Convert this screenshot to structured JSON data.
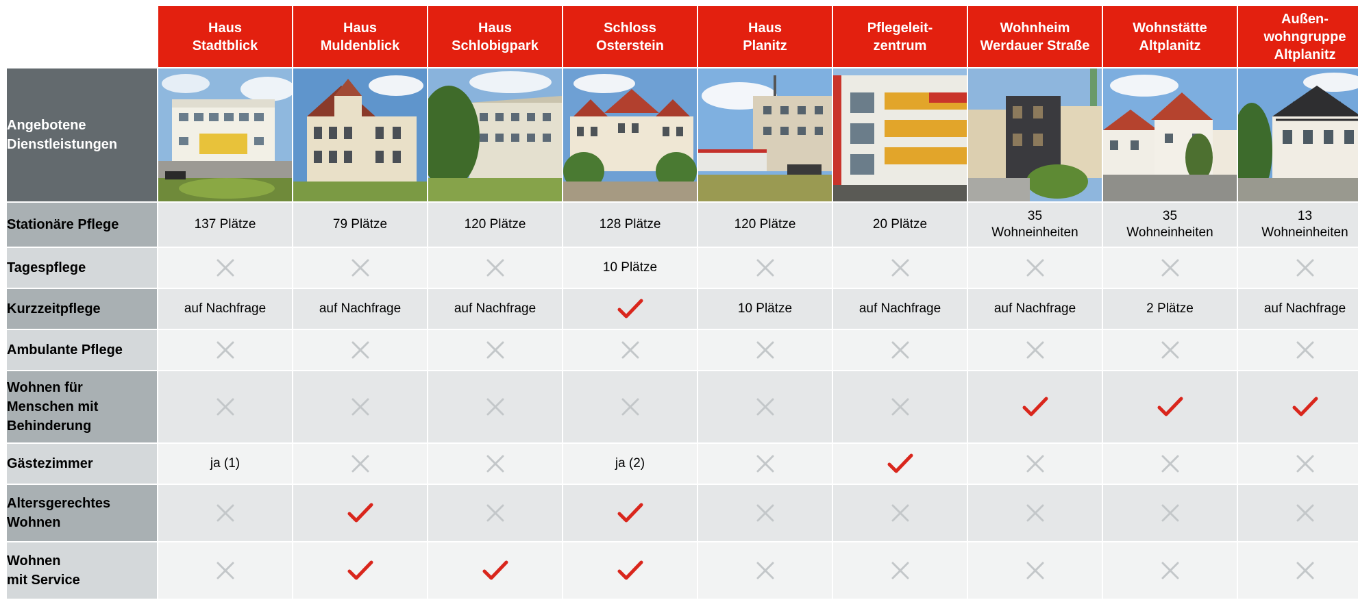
{
  "colors": {
    "brand_red": "#e3200f",
    "label_dark_gray": "#636a6e",
    "check_red": "#d9261c",
    "cross_gray": "#c3c7c9"
  },
  "intro_label": "Angebotene\nDienstleistungen",
  "houses": [
    {
      "name": "Haus\nStadtblick",
      "photo": "photo-haus-stadtblick"
    },
    {
      "name": "Haus\nMuldenblick",
      "photo": "photo-haus-muldenblick"
    },
    {
      "name": "Haus\nSchlobigpark",
      "photo": "photo-haus-schlobigpark"
    },
    {
      "name": "Schloss\nOsterstein",
      "photo": "photo-schloss-osterstein"
    },
    {
      "name": "Haus\nPlanitz",
      "photo": "photo-haus-planitz"
    },
    {
      "name": "Pflegeleit-\nzentrum",
      "photo": "photo-pflegeleitzentrum"
    },
    {
      "name": "Wohnheim\nWerdauer Straße",
      "photo": "photo-wohnheim-werdauer-strasse"
    },
    {
      "name": "Wohnstätte\nAltplanitz",
      "photo": "photo-wohnstaette-altplanitz"
    },
    {
      "name": "Außen-\nwohngruppe\nAltplanitz",
      "photo": "photo-aussenwohngruppe-altplanitz"
    }
  ],
  "icon_legend": {
    "check": "check-icon",
    "cross": "cross-icon"
  },
  "rows": [
    {
      "label": "Stationäre Pflege",
      "cells": [
        {
          "type": "text",
          "text": "137 Plätze"
        },
        {
          "type": "text",
          "text": "79 Plätze"
        },
        {
          "type": "text",
          "text": "120 Plätze"
        },
        {
          "type": "text",
          "text": "128 Plätze"
        },
        {
          "type": "text",
          "text": "120 Plätze"
        },
        {
          "type": "text",
          "text": "20 Plätze"
        },
        {
          "type": "text",
          "text": "35\nWohneinheiten"
        },
        {
          "type": "text",
          "text": "35\nWohneinheiten"
        },
        {
          "type": "text",
          "text": "13\nWohneinheiten"
        }
      ]
    },
    {
      "label": "Tagespflege",
      "cells": [
        {
          "type": "cross"
        },
        {
          "type": "cross"
        },
        {
          "type": "cross"
        },
        {
          "type": "text",
          "text": "10 Plätze"
        },
        {
          "type": "cross"
        },
        {
          "type": "cross"
        },
        {
          "type": "cross"
        },
        {
          "type": "cross"
        },
        {
          "type": "cross"
        }
      ]
    },
    {
      "label": "Kurzzeitpflege",
      "cells": [
        {
          "type": "text",
          "text": "auf Nachfrage"
        },
        {
          "type": "text",
          "text": "auf Nachfrage"
        },
        {
          "type": "text",
          "text": "auf Nachfrage"
        },
        {
          "type": "check"
        },
        {
          "type": "text",
          "text": "10 Plätze"
        },
        {
          "type": "text",
          "text": "auf Nachfrage"
        },
        {
          "type": "text",
          "text": "auf Nachfrage"
        },
        {
          "type": "text",
          "text": "2 Plätze"
        },
        {
          "type": "text",
          "text": "auf Nachfrage"
        }
      ]
    },
    {
      "label": "Ambulante Pflege",
      "cells": [
        {
          "type": "cross"
        },
        {
          "type": "cross"
        },
        {
          "type": "cross"
        },
        {
          "type": "cross"
        },
        {
          "type": "cross"
        },
        {
          "type": "cross"
        },
        {
          "type": "cross"
        },
        {
          "type": "cross"
        },
        {
          "type": "cross"
        }
      ]
    },
    {
      "label": "Wohnen für\nMenschen mit\nBehinderung",
      "cells": [
        {
          "type": "cross"
        },
        {
          "type": "cross"
        },
        {
          "type": "cross"
        },
        {
          "type": "cross"
        },
        {
          "type": "cross"
        },
        {
          "type": "cross"
        },
        {
          "type": "check"
        },
        {
          "type": "check"
        },
        {
          "type": "check"
        }
      ]
    },
    {
      "label": "Gästezimmer",
      "cells": [
        {
          "type": "text",
          "text": "ja (1)"
        },
        {
          "type": "cross"
        },
        {
          "type": "cross"
        },
        {
          "type": "text",
          "text": "ja (2)"
        },
        {
          "type": "cross"
        },
        {
          "type": "check"
        },
        {
          "type": "cross"
        },
        {
          "type": "cross"
        },
        {
          "type": "cross"
        }
      ]
    },
    {
      "label": "Altersgerechtes\nWohnen",
      "cells": [
        {
          "type": "cross"
        },
        {
          "type": "check"
        },
        {
          "type": "cross"
        },
        {
          "type": "check"
        },
        {
          "type": "cross"
        },
        {
          "type": "cross"
        },
        {
          "type": "cross"
        },
        {
          "type": "cross"
        },
        {
          "type": "cross"
        }
      ]
    },
    {
      "label": "Wohnen\nmit Service",
      "cells": [
        {
          "type": "cross"
        },
        {
          "type": "check"
        },
        {
          "type": "check"
        },
        {
          "type": "check"
        },
        {
          "type": "cross"
        },
        {
          "type": "cross"
        },
        {
          "type": "cross"
        },
        {
          "type": "cross"
        },
        {
          "type": "cross"
        }
      ]
    }
  ]
}
